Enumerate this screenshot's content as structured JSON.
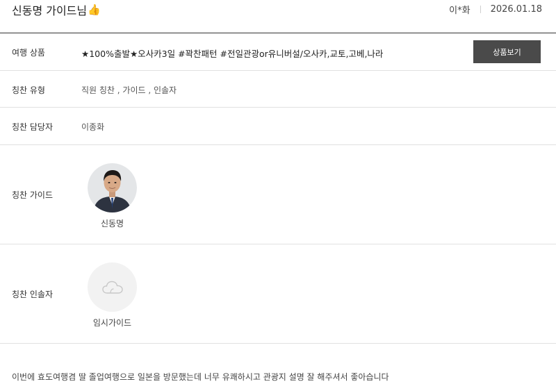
{
  "header": {
    "title": "신동명 가이드님",
    "title_emoji": "👍",
    "reviewer": "이*화",
    "date": "2026.01.18"
  },
  "product": {
    "label": "여행 상품",
    "name": "★100%출발★오사카3일 #꽉찬패턴 #전일관광or유니버설/오사카,교토,고베,나라",
    "button_label": "상품보기"
  },
  "praise_type": {
    "label": "칭찬 유형",
    "value": "직원 칭찬 , 가이드 , 인솔자"
  },
  "praise_manager": {
    "label": "칭찬 담당자",
    "value": "이종화"
  },
  "praise_guide": {
    "label": "칭찬 가이드",
    "name": "신동명"
  },
  "praise_escort": {
    "label": "칭찬 인솔자",
    "name": "임시가이드"
  },
  "review": {
    "text": "이번에 효도여행겸 딸 졸업여행으로 일본을 방문했는데 너무 유쾌하시고 관광지 설명 잘 해주셔서 좋아습니다"
  },
  "colors": {
    "button_bg": "#4a4a4a",
    "header_border": "#333333",
    "row_border": "#e1e1e1"
  },
  "icons": {
    "title_icon": "thumbs-up-icon",
    "placeholder_avatar_icon": "cloud-icon"
  }
}
